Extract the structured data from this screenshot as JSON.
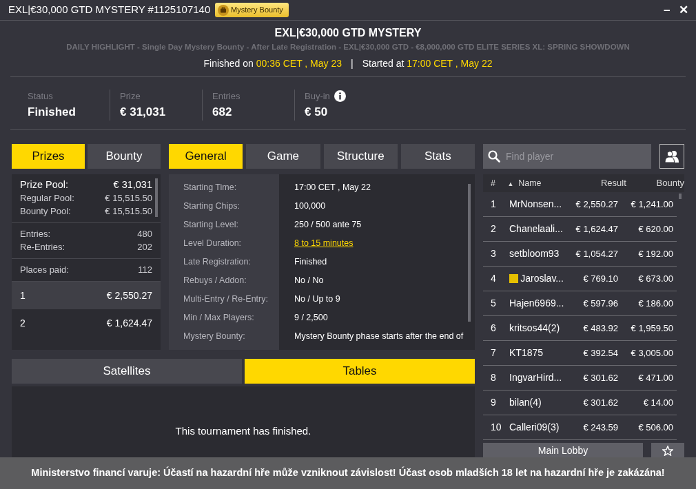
{
  "window": {
    "title": "EXL|€30,000 GTD MYSTERY #1125107140",
    "badge": "Mystery Bounty",
    "minimize": "–",
    "close": "✕"
  },
  "header": {
    "title": "EXL|€30,000 GTD MYSTERY",
    "subtitle": "DAILY HIGHLIGHT - Single Day Mystery Bounty - After Late Registration - EXL|€30,000 GTD  - €8,000,000 GTD ELITE SERIES XL: SPRING SHOWDOWN",
    "finished_label": "Finished on",
    "finished_value": "00:36 CET , May 23",
    "separator": "|",
    "started_label": "Started at",
    "started_value": "17:00 CET , May 22"
  },
  "stats": [
    {
      "label": "Status",
      "value": "Finished",
      "info": false
    },
    {
      "label": "Prize",
      "value": "€ 31,031",
      "info": false
    },
    {
      "label": "Entries",
      "value": "682",
      "info": false
    },
    {
      "label": "Buy-in",
      "value": "€ 50",
      "info": true
    }
  ],
  "prize_tabs": [
    {
      "label": "Prizes",
      "selected": true
    },
    {
      "label": "Bounty",
      "selected": false
    }
  ],
  "prize_groups": [
    [
      {
        "label": "Prize Pool:",
        "value": "€ 31,031",
        "main": true
      },
      {
        "label": "Regular Pool:",
        "value": "€ 15,515.50",
        "main": false
      },
      {
        "label": "Bounty Pool:",
        "value": "€ 15,515.50",
        "main": false
      }
    ],
    [
      {
        "label": "Entries:",
        "value": "480",
        "main": false
      },
      {
        "label": "Re-Entries:",
        "value": "202",
        "main": false
      }
    ],
    [
      {
        "label": "Places paid:",
        "value": "112",
        "main": false
      }
    ]
  ],
  "payouts": [
    {
      "place": "1",
      "amount": "€ 2,550.27"
    },
    {
      "place": "2",
      "amount": "€ 1,624.47"
    }
  ],
  "info_tabs": [
    {
      "label": "General",
      "selected": true
    },
    {
      "label": "Game",
      "selected": false
    },
    {
      "label": "Structure",
      "selected": false
    },
    {
      "label": "Stats",
      "selected": false
    }
  ],
  "general": [
    {
      "label": "Starting Time:",
      "value": "17:00 CET , May 22",
      "link": false
    },
    {
      "label": "Starting Chips:",
      "value": "100,000",
      "link": false
    },
    {
      "label": "Starting Level:",
      "value": "250 / 500 ante 75",
      "link": false
    },
    {
      "label": "Level Duration:",
      "value": "8 to 15 minutes",
      "link": true
    },
    {
      "label": "Late Registration:",
      "value": "Finished",
      "link": false
    },
    {
      "label": "Rebuys / Addon:",
      "value": "No / No",
      "link": false
    },
    {
      "label": "Multi-Entry / Re-Entry:",
      "value": "No / Up to 9",
      "link": false
    },
    {
      "label": "Min / Max Players:",
      "value": "9 / 2,500",
      "link": false
    },
    {
      "label": "Mystery Bounty:",
      "value": "Mystery Bounty phase starts after the end of",
      "link": false
    }
  ],
  "bottom_tabs": [
    {
      "label": "Satellites",
      "selected": false
    },
    {
      "label": "Tables",
      "selected": true
    }
  ],
  "bottom_message": "This tournament has finished.",
  "search": {
    "placeholder": "Find player"
  },
  "players_table": {
    "columns": [
      "#",
      "▲",
      "Name",
      "Result",
      "Bounty"
    ],
    "rows": [
      {
        "rank": "1",
        "name": "MrNonsen...",
        "result": "€ 2,550.27",
        "bounty": "€ 1,241.00"
      },
      {
        "rank": "2",
        "name": "Chanelaali...",
        "result": "€ 1,624.47",
        "bounty": "€ 620.00"
      },
      {
        "rank": "3",
        "name": "setbloom93",
        "result": "€ 1,054.27",
        "bounty": "€ 192.00"
      },
      {
        "rank": "4",
        "name": "Jaroslav...",
        "result": "€ 769.10",
        "bounty": "€ 673.00",
        "color": "#e6c000"
      },
      {
        "rank": "5",
        "name": "Hajen6969...",
        "result": "€ 597.96",
        "bounty": "€ 186.00"
      },
      {
        "rank": "6",
        "name": "kritsos44(2)",
        "result": "€ 483.92",
        "bounty": "€ 1,959.50"
      },
      {
        "rank": "7",
        "name": "KT1875",
        "result": "€ 392.54",
        "bounty": "€ 3,005.00"
      },
      {
        "rank": "8",
        "name": "IngvarHird...",
        "result": "€ 301.62",
        "bounty": "€ 471.00"
      },
      {
        "rank": "9",
        "name": "bilan(4)",
        "result": "€ 301.62",
        "bounty": "€ 14.00"
      },
      {
        "rank": "10",
        "name": "Calleri09(3)",
        "result": "€ 243.59",
        "bounty": "€ 506.00"
      }
    ]
  },
  "main_lobby_button": "Main Lobby",
  "warning_bar": "Ministerstvo financí varuje: Účastí na hazardní hře může vzniknout závislost! Účast osob mladších 18 let na hazardní hře je zakázána!"
}
